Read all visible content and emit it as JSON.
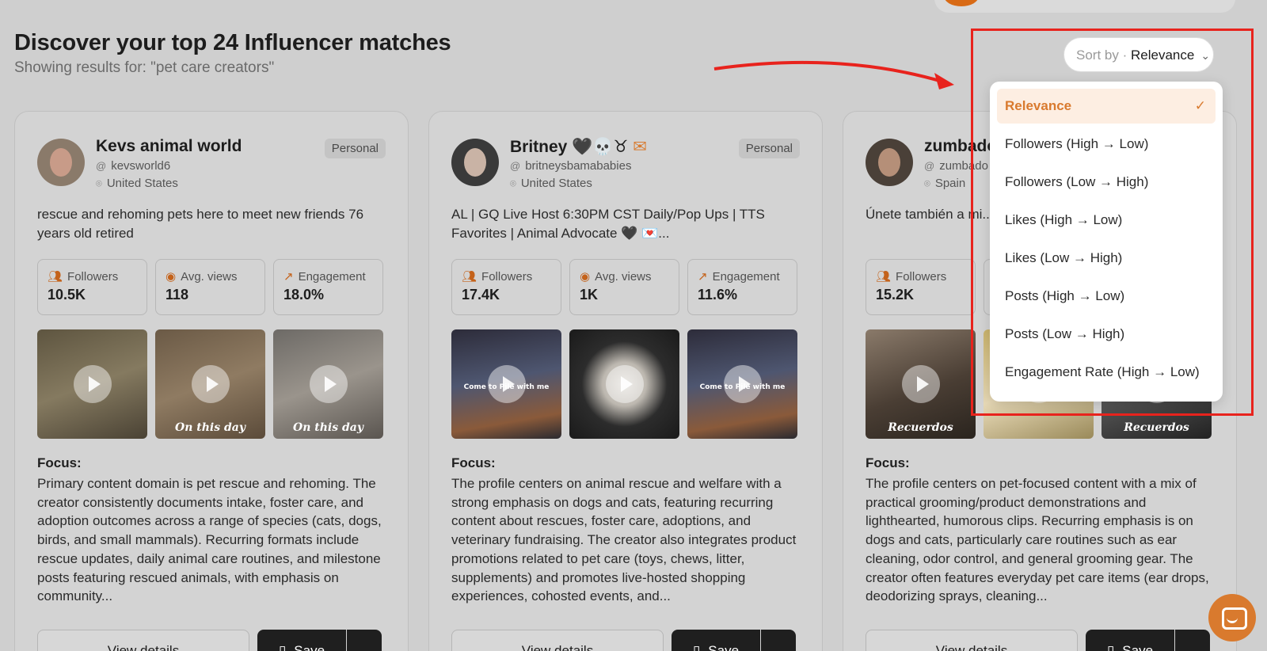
{
  "header": {
    "title": "Discover your top 24 Influencer matches",
    "subtitle": "Showing results for: \"pet care creators\""
  },
  "sort": {
    "label": "Sort by",
    "separator": "·",
    "value": "Relevance",
    "options": [
      {
        "label": "Relevance",
        "selected": true
      },
      {
        "label": "Followers (High → Low)"
      },
      {
        "label": "Followers (Low → High)"
      },
      {
        "label": "Likes (High → Low)"
      },
      {
        "label": "Likes (Low → High)"
      },
      {
        "label": "Posts (High → Low)"
      },
      {
        "label": "Posts (Low → High)"
      },
      {
        "label": "Engagement Rate (High → Low)"
      }
    ]
  },
  "cards": [
    {
      "name": "Kevs animal world",
      "handle": "kevsworld6",
      "location": "United States",
      "badge": "Personal",
      "bio": "rescue and rehoming pets here to meet new friends 76 years old retired",
      "stats": [
        {
          "label": "Followers",
          "value": "10.5K",
          "icon": "users-icon"
        },
        {
          "label": "Avg. views",
          "value": "118",
          "icon": "eye-icon"
        },
        {
          "label": "Engagement",
          "value": "18.0%",
          "icon": "trending-up-icon"
        }
      ],
      "thumb_captions": [
        "",
        "On this day",
        "On this day"
      ],
      "focus_label": "Focus:",
      "focus": "Primary content domain is pet rescue and rehoming. The creator consistently documents intake, foster care, and adoption outcomes across a range of species (cats, dogs, birds, and small mammals). Recurring formats include rescue updates, daily animal care routines, and milestone posts featuring rescued animals, with emphasis on community...",
      "details_label": "View details",
      "save_label": "Save"
    },
    {
      "name": "Britney 🖤💀♉",
      "handle": "britneysbamababies",
      "location": "United States",
      "badge": "Personal",
      "bio": "AL | GQ Live Host 6:30PM CST Daily/Pop Ups | TTS Favorites | Animal Advocate 🖤 💌...",
      "stats": [
        {
          "label": "Followers",
          "value": "17.4K",
          "icon": "users-icon"
        },
        {
          "label": "Avg. views",
          "value": "1K",
          "icon": "eye-icon"
        },
        {
          "label": "Engagement",
          "value": "11.6%",
          "icon": "trending-up-icon"
        }
      ],
      "thumb_captions": [
        "Come to Pile with me",
        "",
        "Come to Pile with me"
      ],
      "focus_label": "Focus:",
      "focus": "The profile centers on animal rescue and welfare with a strong emphasis on dogs and cats, featuring recurring content about rescues, foster care, adoptions, and veterinary fundraising. The creator also integrates product promotions related to pet care (toys, chews, litter, supplements) and promotes live-hosted shopping experiences, cohosted events, and...",
      "details_label": "View details",
      "save_label": "Save"
    },
    {
      "name": "zumbado",
      "handle": "zumbado",
      "location": "Spain",
      "badge": "",
      "bio": "Únete también a mi... vídeos https://yout...",
      "stats": [
        {
          "label": "Followers",
          "value": "15.2K",
          "icon": "users-icon"
        }
      ],
      "thumb_captions": [
        "Recuerdos",
        "",
        "Recuerdos"
      ],
      "focus_label": "Focus:",
      "focus": "The profile centers on pet-focused content with a mix of practical grooming/product demonstrations and lighthearted, humorous clips. Recurring emphasis is on dogs and cats, particularly care routines such as ear cleaning, odor control, and general grooming gear. The creator often features everyday pet care items (ear drops, deodorizing sprays, cleaning...",
      "details_label": "View details",
      "save_label": "Save"
    }
  ],
  "colors": {
    "accent": "#d97a2e",
    "highlight": "#e8231d",
    "overlay": "#cfcfcf"
  }
}
